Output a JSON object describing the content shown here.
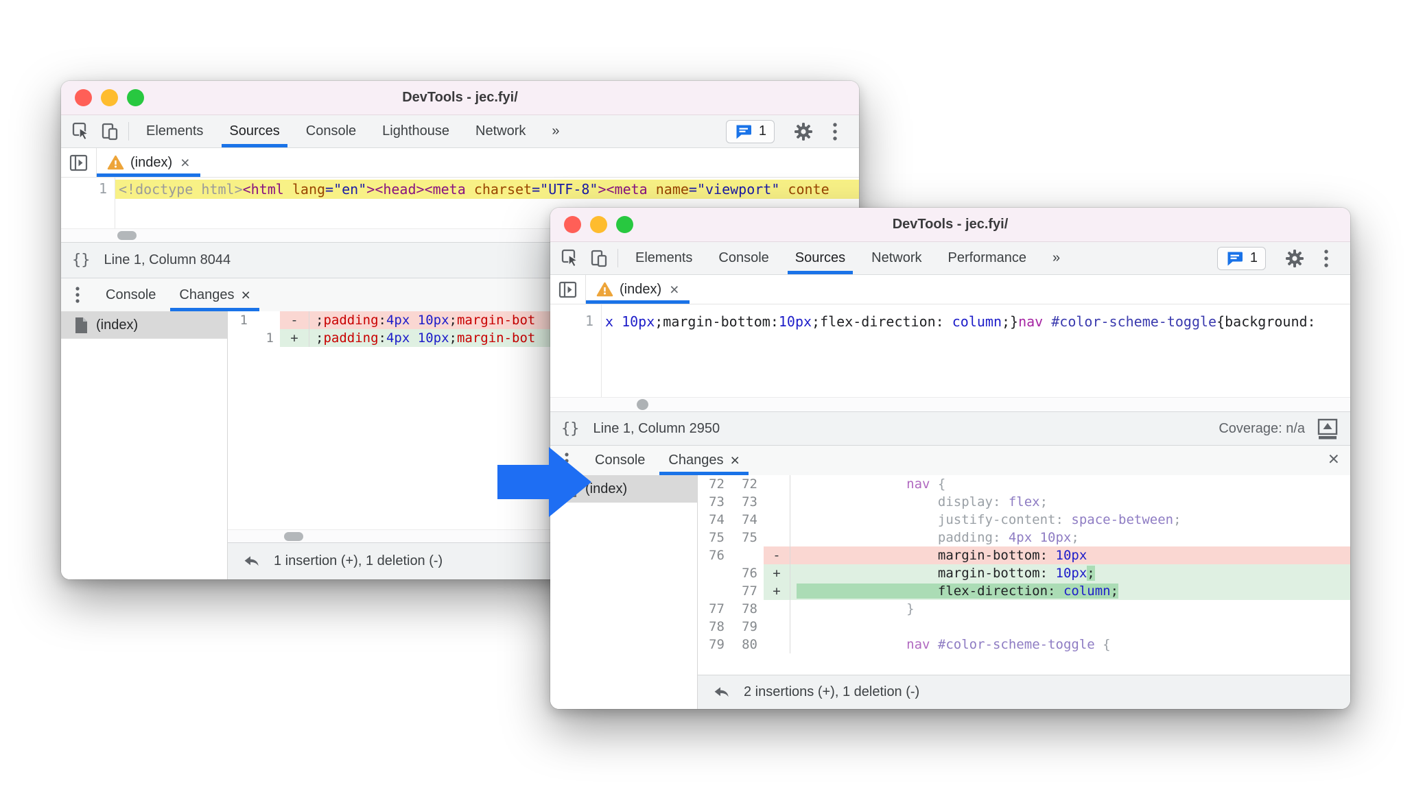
{
  "colors": {
    "accent_blue": "#1a73e8",
    "arrow_blue": "#1e6ef3",
    "diff_delete_bg": "#fad7d2",
    "diff_insert_bg": "#dff0e2",
    "diff_insert_token_bg": "#abdcb5",
    "code_line_highlight_yellow": "#f8f186",
    "traffic_red": "#ff5f57",
    "traffic_yellow": "#febc2e",
    "traffic_green": "#28c840"
  },
  "icons": [
    "inspect-icon",
    "device-toolbar-icon",
    "issues-chat-icon",
    "settings-gear-icon",
    "kebab-menu-icon",
    "panel-expand-icon",
    "warning-icon",
    "braces-icon",
    "file-icon",
    "undo-icon",
    "coverage-dock-icon",
    "close-icon",
    "more-tabs-chevron"
  ],
  "back": {
    "title": "DevTools - jec.fyi/",
    "tabs": [
      {
        "label": "Elements"
      },
      {
        "label": "Sources",
        "active": true
      },
      {
        "label": "Console"
      },
      {
        "label": "Lighthouse"
      },
      {
        "label": "Network"
      },
      {
        "label": "»"
      }
    ],
    "issues_count": "1",
    "file_tab": {
      "label": "(index)",
      "close": "×"
    },
    "code": {
      "line_number": "1",
      "segments": [
        [
          "<!doctype html>",
          "doc"
        ],
        [
          "<html ",
          "tag"
        ],
        [
          "lang",
          "attr"
        ],
        [
          "=\"en\"",
          "attv"
        ],
        [
          ">",
          "tag"
        ],
        [
          "<head>",
          "tag"
        ],
        [
          "<meta ",
          "tag"
        ],
        [
          "charset",
          "attr"
        ],
        [
          "=\"UTF-8\"",
          "attv"
        ],
        [
          ">",
          "tag"
        ],
        [
          "<meta ",
          "tag"
        ],
        [
          "name",
          "attr"
        ],
        [
          "=\"viewport\"",
          "attv"
        ],
        [
          " ",
          ""
        ],
        [
          "conte",
          "attr"
        ]
      ]
    },
    "status": {
      "icon": "{}",
      "text": "Line 1, Column 8044"
    },
    "drawer": {
      "tabs": [
        {
          "label": "Console"
        },
        {
          "label": "Changes",
          "active": true,
          "close": "×"
        }
      ],
      "file": "(index)",
      "rows": [
        {
          "old": "1",
          "new": "",
          "mark": "-",
          "kind": "del",
          "code": [
            [
              ";",
              "pun"
            ],
            [
              "padding",
              "prop"
            ],
            [
              ":",
              "pun"
            ],
            [
              "4px",
              "val"
            ],
            [
              " ",
              ""
            ],
            [
              "10px",
              "val"
            ],
            [
              ";",
              "pun"
            ],
            [
              "margin-bot",
              "prop"
            ]
          ]
        },
        {
          "old": "",
          "new": "1",
          "mark": "+",
          "kind": "ins",
          "code": [
            [
              ";",
              "pun"
            ],
            [
              "padding",
              "prop"
            ],
            [
              ":",
              "pun"
            ],
            [
              "4px",
              "val"
            ],
            [
              " ",
              ""
            ],
            [
              "10px",
              "val"
            ],
            [
              ";",
              "pun"
            ],
            [
              "margin-bot",
              "prop"
            ]
          ]
        }
      ],
      "footer": "1 insertion (+), 1 deletion (-)"
    }
  },
  "front": {
    "title": "DevTools - jec.fyi/",
    "tabs": [
      {
        "label": "Elements"
      },
      {
        "label": "Console"
      },
      {
        "label": "Sources",
        "active": true
      },
      {
        "label": "Network"
      },
      {
        "label": "Performance"
      },
      {
        "label": "»"
      }
    ],
    "issues_count": "1",
    "file_tab": {
      "label": "(index)",
      "close": "×"
    },
    "code": {
      "line_number": "1",
      "segments": [
        [
          "x 10px",
          "val2"
        ],
        [
          ";margin-bottom:",
          "pun2"
        ],
        [
          "10px",
          "val2"
        ],
        [
          ";flex-direction: ",
          "pun2"
        ],
        [
          "column",
          "val2"
        ],
        [
          ";}",
          "pun2"
        ],
        [
          "nav ",
          "tag2"
        ],
        [
          "#color-scheme-toggle",
          "id2"
        ],
        [
          "{background:",
          "pun2"
        ]
      ]
    },
    "status": {
      "icon": "{}",
      "text": "Line 1, Column 2950",
      "coverage": "Coverage: n/a"
    },
    "drawer": {
      "tabs": [
        {
          "label": "Console"
        },
        {
          "label": "Changes",
          "active": true,
          "close": "×"
        }
      ],
      "close": "×",
      "file": "(index)",
      "rows": [
        {
          "old": "72",
          "new": "72",
          "mark": "",
          "kind": "ctx",
          "code": [
            [
              "              ",
              ""
            ],
            [
              "nav ",
              "tagd"
            ],
            [
              "{",
              "dim"
            ]
          ]
        },
        {
          "old": "73",
          "new": "73",
          "mark": "",
          "kind": "ctx",
          "code": [
            [
              "                  ",
              ""
            ],
            [
              "display: ",
              "dim"
            ],
            [
              "flex",
              "vald"
            ],
            [
              ";",
              "dim"
            ]
          ]
        },
        {
          "old": "74",
          "new": "74",
          "mark": "",
          "kind": "ctx",
          "code": [
            [
              "                  ",
              ""
            ],
            [
              "justify-content: ",
              "dim"
            ],
            [
              "space-between",
              "vald"
            ],
            [
              ";",
              "dim"
            ]
          ]
        },
        {
          "old": "75",
          "new": "75",
          "mark": "",
          "kind": "ctx",
          "code": [
            [
              "                  ",
              ""
            ],
            [
              "padding: ",
              "dim"
            ],
            [
              "4px 10px",
              "vald"
            ],
            [
              ";",
              "dim"
            ]
          ]
        },
        {
          "old": "76",
          "new": "",
          "mark": "-",
          "kind": "del",
          "code": [
            [
              "                  ",
              ""
            ],
            [
              "margin-bottom: ",
              "strong"
            ],
            [
              "10px",
              "val"
            ]
          ]
        },
        {
          "old": "",
          "new": "76",
          "mark": "+",
          "kind": "ins",
          "code": [
            [
              "                  ",
              ""
            ],
            [
              "margin-bottom: ",
              "strong"
            ],
            [
              "10px",
              "val"
            ],
            [
              ";",
              "strong tokg"
            ]
          ]
        },
        {
          "old": "",
          "new": "77",
          "mark": "+",
          "kind": "ins",
          "code": [
            [
              "                  ",
              "tokg"
            ],
            [
              "flex-direction: ",
              "strong tokg"
            ],
            [
              "column",
              "val tokg"
            ],
            [
              ";",
              "strong tokg"
            ]
          ]
        },
        {
          "old": "77",
          "new": "78",
          "mark": "",
          "kind": "ctx",
          "code": [
            [
              "              ",
              ""
            ],
            [
              "}",
              "dim"
            ]
          ]
        },
        {
          "old": "78",
          "new": "79",
          "mark": "",
          "kind": "ctx",
          "code": []
        },
        {
          "old": "79",
          "new": "80",
          "mark": "",
          "kind": "ctx",
          "code": [
            [
              "              ",
              ""
            ],
            [
              "nav ",
              "tagd"
            ],
            [
              "#color-scheme-toggle ",
              "vald"
            ],
            [
              "{",
              "dim"
            ]
          ]
        }
      ],
      "footer": "2 insertions (+), 1 deletion (-)"
    }
  }
}
